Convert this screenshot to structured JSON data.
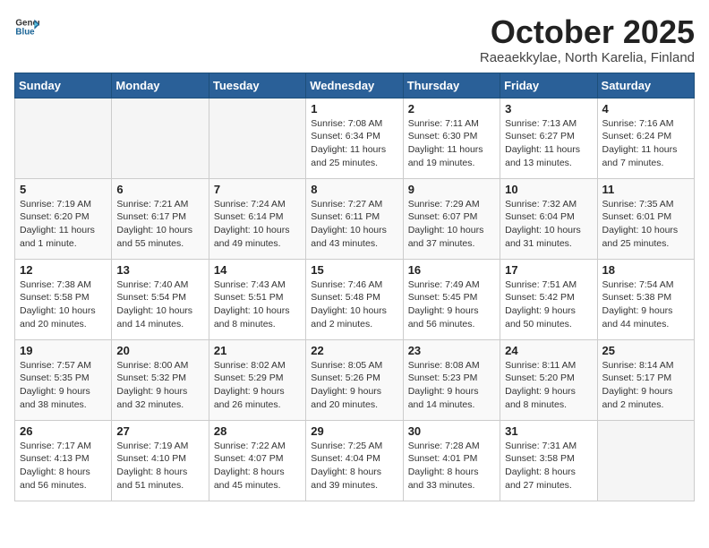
{
  "logo": {
    "general": "General",
    "blue": "Blue"
  },
  "title": "October 2025",
  "subtitle": "Raeaekkylae, North Karelia, Finland",
  "headers": [
    "Sunday",
    "Monday",
    "Tuesday",
    "Wednesday",
    "Thursday",
    "Friday",
    "Saturday"
  ],
  "weeks": [
    [
      {
        "day": "",
        "info": ""
      },
      {
        "day": "",
        "info": ""
      },
      {
        "day": "",
        "info": ""
      },
      {
        "day": "1",
        "info": "Sunrise: 7:08 AM\nSunset: 6:34 PM\nDaylight: 11 hours\nand 25 minutes."
      },
      {
        "day": "2",
        "info": "Sunrise: 7:11 AM\nSunset: 6:30 PM\nDaylight: 11 hours\nand 19 minutes."
      },
      {
        "day": "3",
        "info": "Sunrise: 7:13 AM\nSunset: 6:27 PM\nDaylight: 11 hours\nand 13 minutes."
      },
      {
        "day": "4",
        "info": "Sunrise: 7:16 AM\nSunset: 6:24 PM\nDaylight: 11 hours\nand 7 minutes."
      }
    ],
    [
      {
        "day": "5",
        "info": "Sunrise: 7:19 AM\nSunset: 6:20 PM\nDaylight: 11 hours\nand 1 minute."
      },
      {
        "day": "6",
        "info": "Sunrise: 7:21 AM\nSunset: 6:17 PM\nDaylight: 10 hours\nand 55 minutes."
      },
      {
        "day": "7",
        "info": "Sunrise: 7:24 AM\nSunset: 6:14 PM\nDaylight: 10 hours\nand 49 minutes."
      },
      {
        "day": "8",
        "info": "Sunrise: 7:27 AM\nSunset: 6:11 PM\nDaylight: 10 hours\nand 43 minutes."
      },
      {
        "day": "9",
        "info": "Sunrise: 7:29 AM\nSunset: 6:07 PM\nDaylight: 10 hours\nand 37 minutes."
      },
      {
        "day": "10",
        "info": "Sunrise: 7:32 AM\nSunset: 6:04 PM\nDaylight: 10 hours\nand 31 minutes."
      },
      {
        "day": "11",
        "info": "Sunrise: 7:35 AM\nSunset: 6:01 PM\nDaylight: 10 hours\nand 25 minutes."
      }
    ],
    [
      {
        "day": "12",
        "info": "Sunrise: 7:38 AM\nSunset: 5:58 PM\nDaylight: 10 hours\nand 20 minutes."
      },
      {
        "day": "13",
        "info": "Sunrise: 7:40 AM\nSunset: 5:54 PM\nDaylight: 10 hours\nand 14 minutes."
      },
      {
        "day": "14",
        "info": "Sunrise: 7:43 AM\nSunset: 5:51 PM\nDaylight: 10 hours\nand 8 minutes."
      },
      {
        "day": "15",
        "info": "Sunrise: 7:46 AM\nSunset: 5:48 PM\nDaylight: 10 hours\nand 2 minutes."
      },
      {
        "day": "16",
        "info": "Sunrise: 7:49 AM\nSunset: 5:45 PM\nDaylight: 9 hours\nand 56 minutes."
      },
      {
        "day": "17",
        "info": "Sunrise: 7:51 AM\nSunset: 5:42 PM\nDaylight: 9 hours\nand 50 minutes."
      },
      {
        "day": "18",
        "info": "Sunrise: 7:54 AM\nSunset: 5:38 PM\nDaylight: 9 hours\nand 44 minutes."
      }
    ],
    [
      {
        "day": "19",
        "info": "Sunrise: 7:57 AM\nSunset: 5:35 PM\nDaylight: 9 hours\nand 38 minutes."
      },
      {
        "day": "20",
        "info": "Sunrise: 8:00 AM\nSunset: 5:32 PM\nDaylight: 9 hours\nand 32 minutes."
      },
      {
        "day": "21",
        "info": "Sunrise: 8:02 AM\nSunset: 5:29 PM\nDaylight: 9 hours\nand 26 minutes."
      },
      {
        "day": "22",
        "info": "Sunrise: 8:05 AM\nSunset: 5:26 PM\nDaylight: 9 hours\nand 20 minutes."
      },
      {
        "day": "23",
        "info": "Sunrise: 8:08 AM\nSunset: 5:23 PM\nDaylight: 9 hours\nand 14 minutes."
      },
      {
        "day": "24",
        "info": "Sunrise: 8:11 AM\nSunset: 5:20 PM\nDaylight: 9 hours\nand 8 minutes."
      },
      {
        "day": "25",
        "info": "Sunrise: 8:14 AM\nSunset: 5:17 PM\nDaylight: 9 hours\nand 2 minutes."
      }
    ],
    [
      {
        "day": "26",
        "info": "Sunrise: 7:17 AM\nSunset: 4:13 PM\nDaylight: 8 hours\nand 56 minutes."
      },
      {
        "day": "27",
        "info": "Sunrise: 7:19 AM\nSunset: 4:10 PM\nDaylight: 8 hours\nand 51 minutes."
      },
      {
        "day": "28",
        "info": "Sunrise: 7:22 AM\nSunset: 4:07 PM\nDaylight: 8 hours\nand 45 minutes."
      },
      {
        "day": "29",
        "info": "Sunrise: 7:25 AM\nSunset: 4:04 PM\nDaylight: 8 hours\nand 39 minutes."
      },
      {
        "day": "30",
        "info": "Sunrise: 7:28 AM\nSunset: 4:01 PM\nDaylight: 8 hours\nand 33 minutes."
      },
      {
        "day": "31",
        "info": "Sunrise: 7:31 AM\nSunset: 3:58 PM\nDaylight: 8 hours\nand 27 minutes."
      },
      {
        "day": "",
        "info": ""
      }
    ]
  ]
}
